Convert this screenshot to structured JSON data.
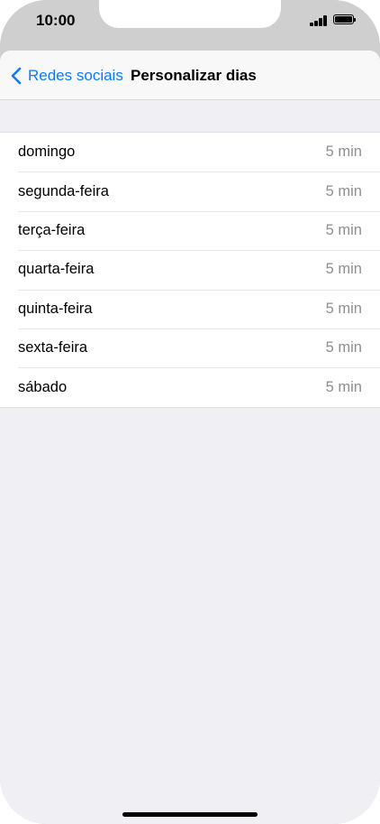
{
  "status_bar": {
    "time": "10:00",
    "icons": [
      "signal-icon",
      "battery-icon"
    ]
  },
  "nav": {
    "back_label": "Redes sociais",
    "title": "Personalizar dias",
    "back_icon": "chevron-left-icon"
  },
  "days": [
    {
      "label": "domingo",
      "value": "5 min"
    },
    {
      "label": "segunda-feira",
      "value": "5 min"
    },
    {
      "label": "terça-feira",
      "value": "5 min"
    },
    {
      "label": "quarta-feira",
      "value": "5 min"
    },
    {
      "label": "quinta-feira",
      "value": "5 min"
    },
    {
      "label": "sexta-feira",
      "value": "5 min"
    },
    {
      "label": "sábado",
      "value": "5 min"
    }
  ],
  "colors": {
    "accent": "#0a7aff",
    "background": "#efeff4",
    "secondary_text": "#8e8e93"
  }
}
